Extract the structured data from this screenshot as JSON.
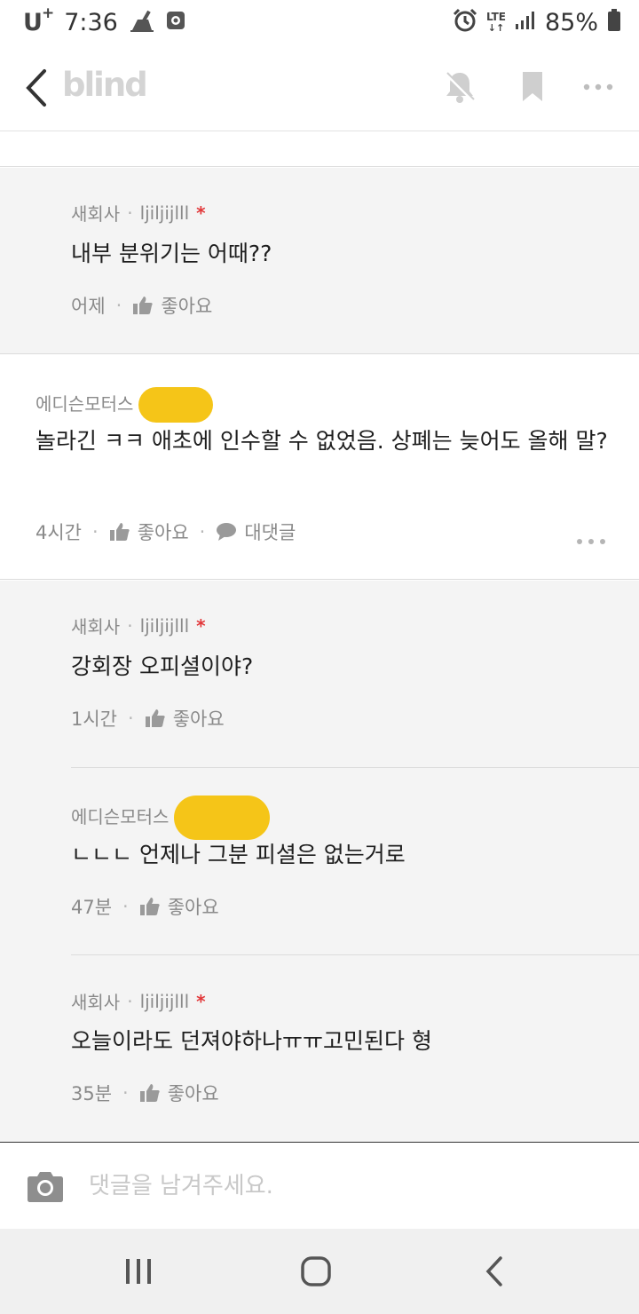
{
  "status_bar": {
    "carrier": "U",
    "carrier_plus": "+",
    "time": "7:36",
    "network": "LTE",
    "battery": "85%"
  },
  "header": {
    "logo": "blind",
    "icons": [
      "back-chevron-icon",
      "notification-off-icon",
      "bookmark-icon",
      "more-icon"
    ]
  },
  "comments": [
    {
      "company": "새회사",
      "nickname": "ljiljijlll",
      "author_mark": "*",
      "text": "내부 분위기는 어때??",
      "time": "어제",
      "like_label": "좋아요"
    },
    {
      "company": "에디슨모터스",
      "text": "놀라긴 ㅋㅋ 애초에 인수할 수 없었음. 상폐는 늦어도 올해 말?",
      "time": "4시간",
      "like_label": "좋아요",
      "reply_label": "대댓글"
    },
    {
      "company": "새회사",
      "nickname": "ljiljijlll",
      "author_mark": "*",
      "text": "강회장 오피셜이야?",
      "time": "1시간",
      "like_label": "좋아요"
    },
    {
      "company": "에디슨모터스",
      "text": "ㄴㄴㄴ 언제나 그분 피셜은 없는거로",
      "time": "47분",
      "like_label": "좋아요"
    },
    {
      "company": "새회사",
      "nickname": "ljiljijlll",
      "author_mark": "*",
      "text": "오늘이라도 던져야하나ㅠㅠ고민된다 형",
      "time": "35분",
      "like_label": "좋아요"
    }
  ],
  "input": {
    "placeholder": "댓글을 남겨주세요."
  },
  "colors": {
    "accent_star": "#e2383a",
    "redaction": "#f5c518",
    "reply_bg": "#f4f4f4"
  }
}
